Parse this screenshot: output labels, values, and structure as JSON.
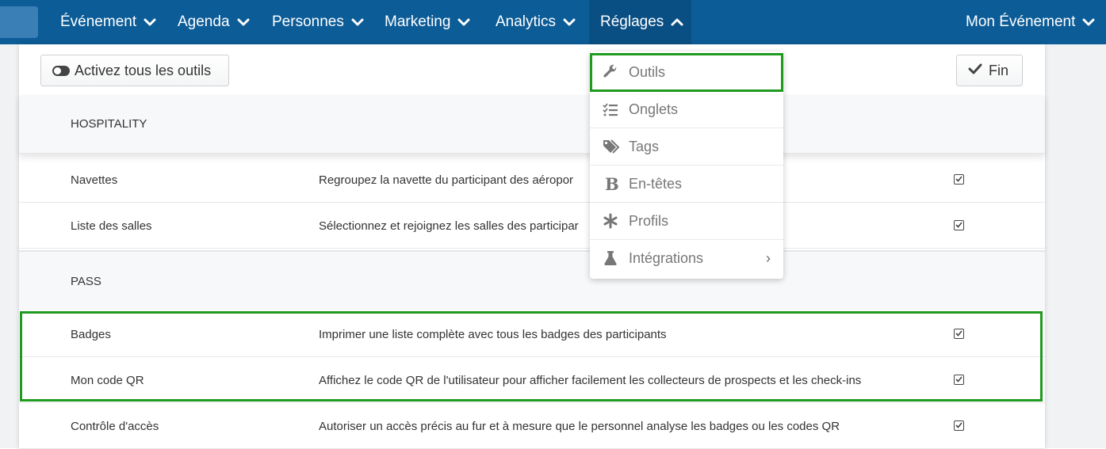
{
  "nav": {
    "items": [
      {
        "label": "Événement"
      },
      {
        "label": "Agenda"
      },
      {
        "label": "Personnes"
      },
      {
        "label": "Marketing"
      },
      {
        "label": "Analytics"
      },
      {
        "label": "Réglages",
        "active": true
      }
    ],
    "event_label": "Mon Événement"
  },
  "toolbar": {
    "toggle_all_label": "Activez tous les outils",
    "done_label": "Fin"
  },
  "sections": [
    {
      "title": "HOSPITALITY",
      "rows": [
        {
          "name": "Navettes",
          "desc": "Regroupez la navette du participant des aéropor",
          "checked": true
        },
        {
          "name": "Liste des salles",
          "desc": "Sélectionnez et rejoignez les salles des participar",
          "checked": true
        }
      ]
    },
    {
      "title": "PASS",
      "rows": [
        {
          "name": "Badges",
          "desc": "Imprimer une liste complète avec tous les badges des participants",
          "checked": true
        },
        {
          "name": "Mon code QR",
          "desc": "Affichez le code QR de l'utilisateur pour afficher facilement les collecteurs de prospects et les check-ins",
          "checked": true
        },
        {
          "name": "Contrôle d'accès",
          "desc": "Autoriser un accès précis au fur et à mesure que le personnel analyse les badges ou les codes QR",
          "checked": true
        }
      ]
    }
  ],
  "dropdown": {
    "items": [
      {
        "label": "Outils",
        "icon": "wrench-icon",
        "highlighted": true
      },
      {
        "label": "Onglets",
        "icon": "list-check-icon"
      },
      {
        "label": "Tags",
        "icon": "tags-icon"
      },
      {
        "label": "En-têtes",
        "icon": "bold-icon"
      },
      {
        "label": "Profils",
        "icon": "asterisk-icon"
      },
      {
        "label": "Intégrations",
        "icon": "flask-icon",
        "submenu": true
      }
    ],
    "submenu_arrow": "›"
  },
  "colors": {
    "nav_bg": "#0c5c97",
    "nav_active_bg": "#0a4f83",
    "highlight": "#1f9a1f"
  }
}
